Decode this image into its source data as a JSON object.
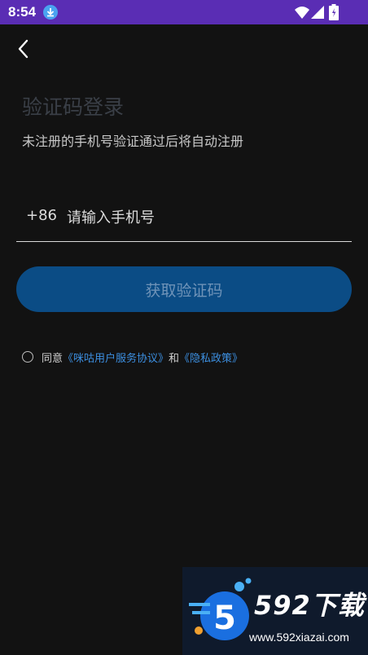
{
  "status_bar": {
    "time": "8:54",
    "icons": [
      "download-icon",
      "wifi-icon",
      "signal-icon",
      "battery-icon"
    ],
    "color": "#5a2db4"
  },
  "header": {
    "back_icon": "chevron-left-icon"
  },
  "login": {
    "title": "验证码登录",
    "subtitle": "未注册的手机号验证通过后将自动注册",
    "country_code": "+86",
    "phone_placeholder": "请输入手机号",
    "get_code_label": "获取验证码",
    "button_color": "#0b4c85"
  },
  "agreement": {
    "prefix": "同意",
    "user_agreement": "《咪咕用户服务协议》",
    "conjunction": "和",
    "privacy_policy": "《隐私政策》",
    "link_color": "#3c8fe0"
  },
  "watermark": {
    "title": "592下载",
    "url": "www.592xiazai.com"
  }
}
